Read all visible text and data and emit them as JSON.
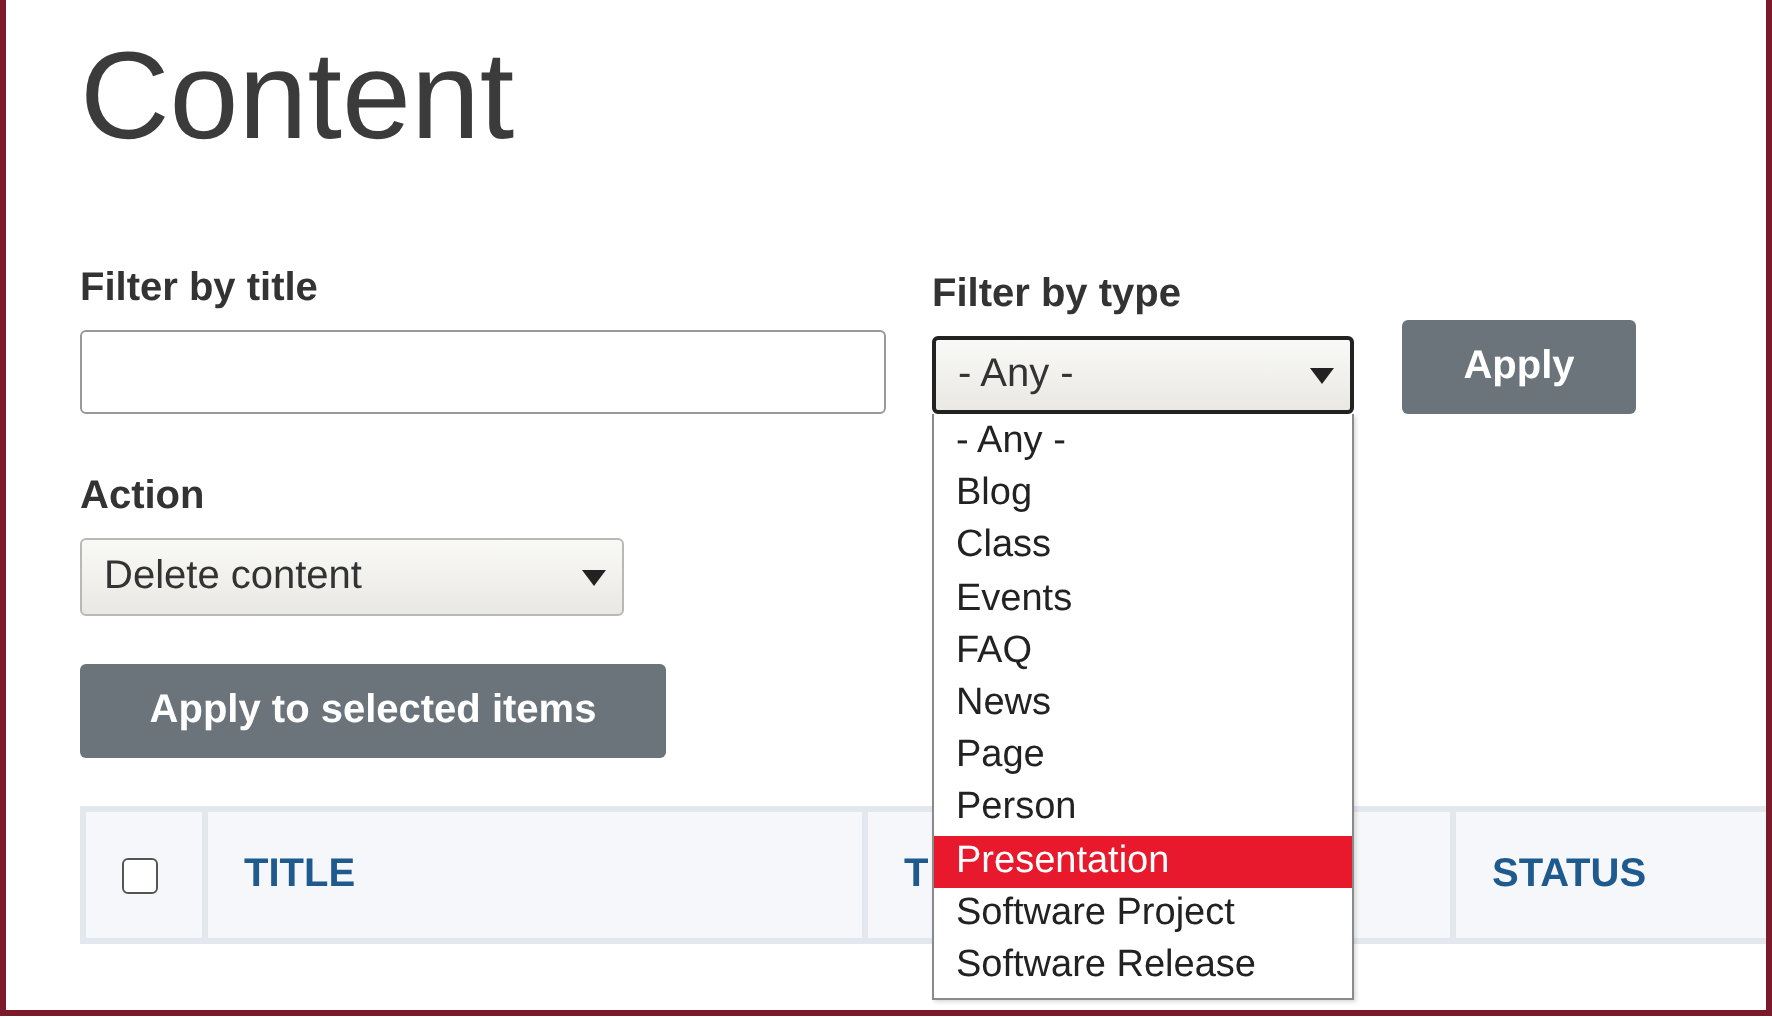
{
  "page_title": "Content",
  "title_filter": {
    "label": "Filter by title"
  },
  "type_filter": {
    "label": "Filter by type",
    "value": "- Any -",
    "expanded": true,
    "options": [
      {
        "label": "- Any -",
        "highlighted": false
      },
      {
        "label": "Blog",
        "highlighted": false
      },
      {
        "label": "Class",
        "highlighted": false
      },
      {
        "label": "Events",
        "highlighted": false
      },
      {
        "label": "FAQ",
        "highlighted": false
      },
      {
        "label": "News",
        "highlighted": false
      },
      {
        "label": "Page",
        "highlighted": false
      },
      {
        "label": "Person",
        "highlighted": false
      },
      {
        "label": "Presentation",
        "highlighted": true
      },
      {
        "label": "Software Project",
        "highlighted": false
      },
      {
        "label": "Software Release",
        "highlighted": false
      }
    ]
  },
  "apply_button": "Apply",
  "action": {
    "label": "Action",
    "value": "Delete content"
  },
  "bulk_button": "Apply to selected items",
  "table": {
    "select_all_checked": false,
    "columns": [
      "TITLE",
      "T",
      "STATUS"
    ]
  }
}
